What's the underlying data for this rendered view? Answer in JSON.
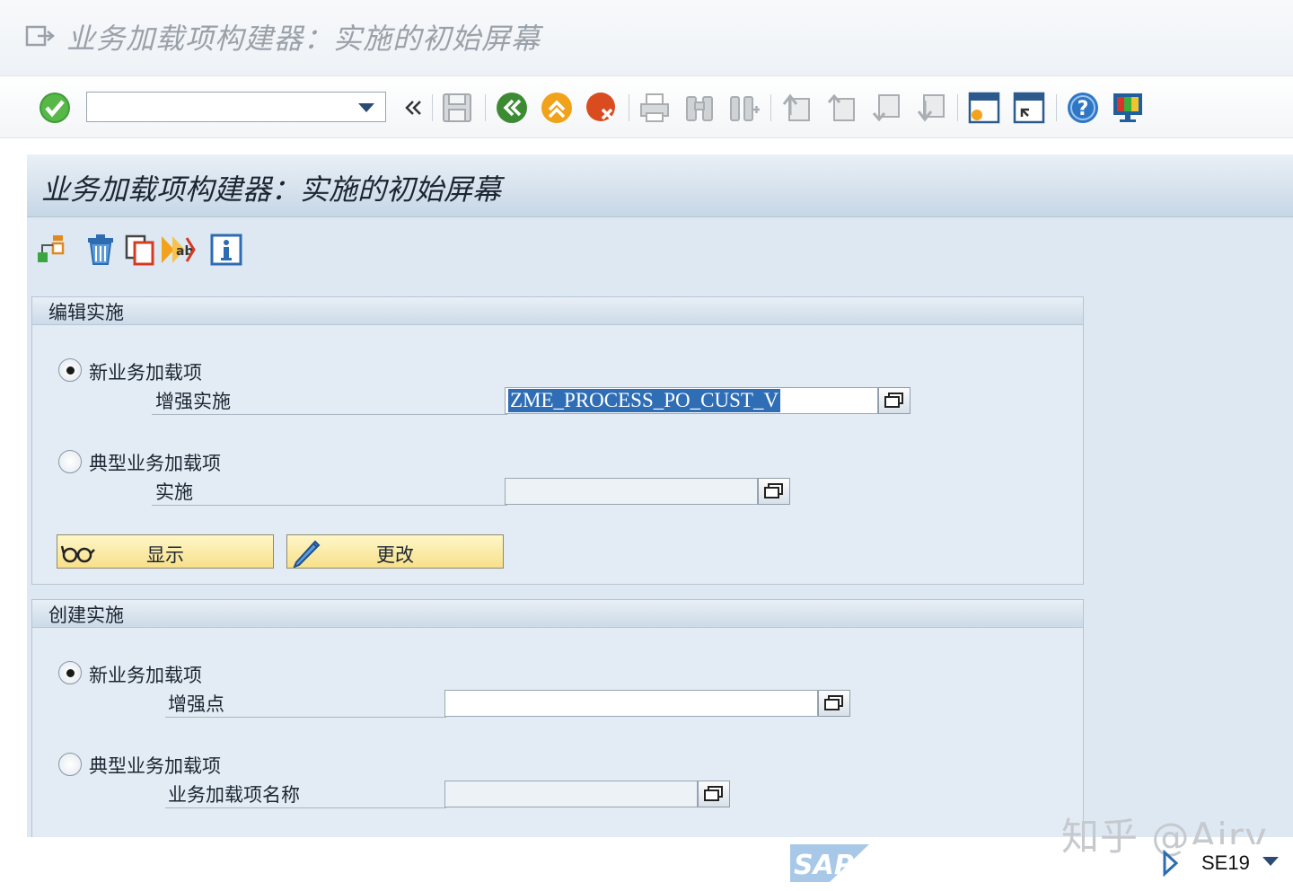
{
  "window": {
    "title": "业务加载项构建器：实施的初始屏幕"
  },
  "toolbar": {
    "command_field_value": "",
    "icons": [
      "enter-icon",
      "back-icon",
      "exit-icon",
      "cancel-icon",
      "print-icon",
      "find-icon",
      "find-next-icon",
      "first-page-icon",
      "previous-page-icon",
      "next-page-icon",
      "last-page-icon",
      "new-session-icon",
      "shortcut-icon",
      "help-icon",
      "layout-icon"
    ]
  },
  "screen": {
    "title": "业务加载项构建器：实施的初始屏幕",
    "app_icons": [
      "hierarchy-icon",
      "delete-icon",
      "copy-icon",
      "rename-icon",
      "info-icon"
    ]
  },
  "edit_group": {
    "title": "编辑实施",
    "option_new": {
      "label": "新业务加载项",
      "selected": true
    },
    "enhancement_impl": {
      "label": "增强实施",
      "value": "ZME_PROCESS_PO_CUST_V"
    },
    "option_classic": {
      "label": "典型业务加载项",
      "selected": false
    },
    "implementation": {
      "label": "实施",
      "value": ""
    },
    "display_button": "显示",
    "change_button": "更改"
  },
  "create_group": {
    "title": "创建实施",
    "option_new": {
      "label": "新业务加载项",
      "selected": true
    },
    "enhancement_spot": {
      "label": "增强点",
      "value": ""
    },
    "option_classic": {
      "label": "典型业务加载项",
      "selected": false
    },
    "badi_name": {
      "label": "业务加载项名称",
      "value": ""
    }
  },
  "status": {
    "logo": "SAP",
    "transaction": "SE19",
    "watermark": "知乎 @Airy"
  }
}
